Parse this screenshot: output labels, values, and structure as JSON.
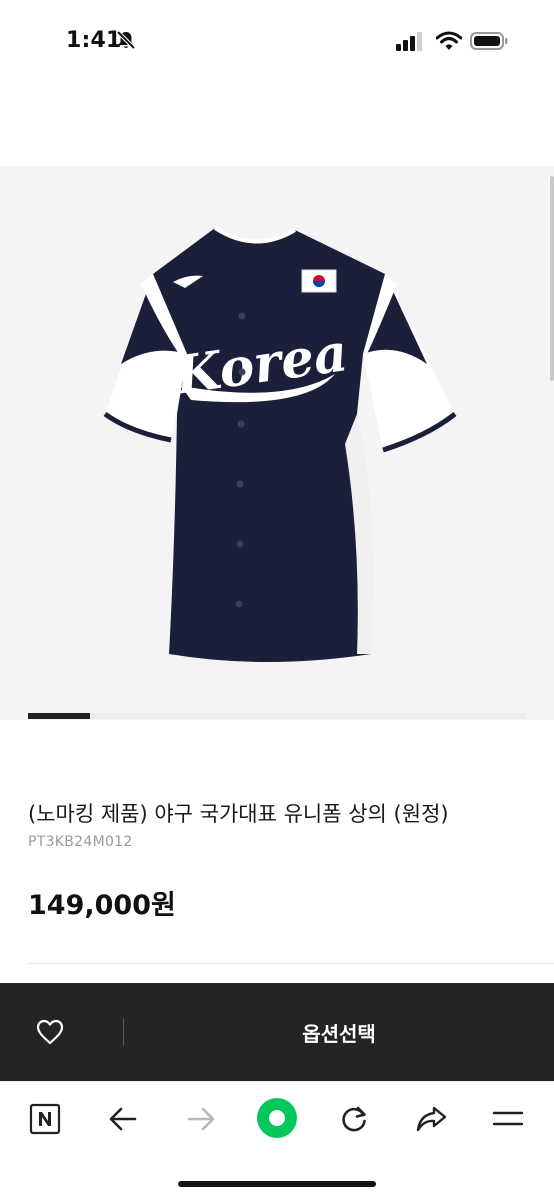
{
  "status_bar": {
    "time": "1:41",
    "icons": [
      "bell-slash-icon",
      "cellular-signal-icon",
      "wifi-icon",
      "battery-icon"
    ]
  },
  "product": {
    "image_alt": "Korea baseball jersey",
    "jersey_text": "Korea",
    "image_count_indicator": {
      "current": 1
    },
    "title": "(노마킹 제품) 야구 국가대표 유니폼 상의 (원정)",
    "code": "PT3KB24M012",
    "price": "149,000원"
  },
  "purchase_bar": {
    "wishlist_icon": "heart-icon",
    "option_button_label": "옵션선택"
  },
  "browser_toolbar": {
    "items": [
      "naver-icon",
      "back-arrow-icon",
      "forward-arrow-icon",
      "green-home-icon",
      "reload-icon",
      "share-icon",
      "menu-icon"
    ]
  },
  "colors": {
    "jersey_navy": "#1b1f3a",
    "buy_bar": "#242424",
    "naver_green": "#03c75a",
    "disabled_gray": "#b8b8b8"
  }
}
